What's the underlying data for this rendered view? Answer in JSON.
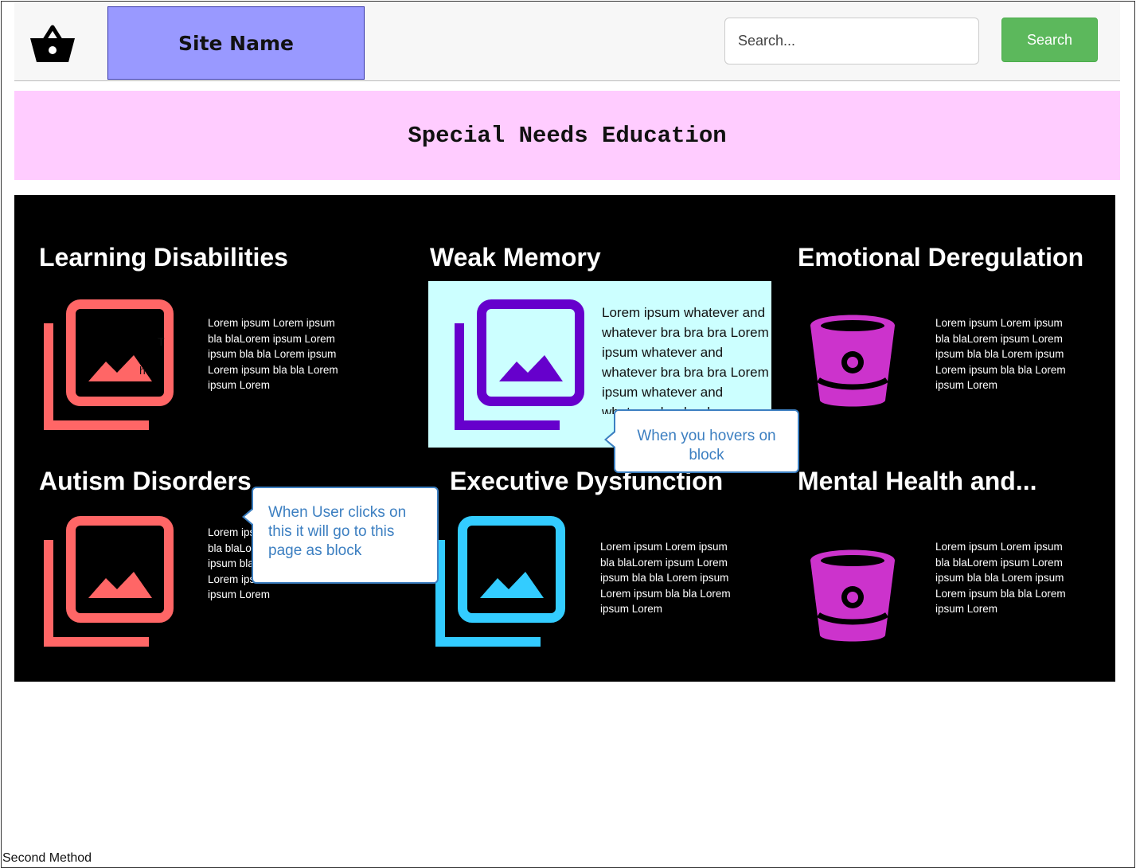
{
  "header": {
    "site_name": "Site Name",
    "search_placeholder": "Search...",
    "search_button": "Search"
  },
  "banner": {
    "title": "Special Needs Education"
  },
  "cards": [
    {
      "title": "Learning Disabilities",
      "icon": "image-gallery-icon",
      "color": "#ff6666",
      "text": "Lorem ipsum Lorem ipsum bla blaLorem ipsum Lorem ipsum bla bla Lorem ipsum Lorem ipsum bla bla Lorem ipsum Lorem"
    },
    {
      "title": "Weak Memory",
      "icon": "image-gallery-icon",
      "color": "#6600cc",
      "text": "Lorem ipsum whatever and whatever bra bra bra Lorem ipsum whatever and whatever bra bra bra Lorem ipsum whatever and whatever bra bra bra"
    },
    {
      "title": "Emotional Deregulation",
      "icon": "bitbucket-icon",
      "color": "#cc33cc",
      "text": "Lorem ipsum Lorem ipsum bla blaLorem ipsum Lorem ipsum bla bla Lorem ipsum Lorem ipsum bla bla Lorem ipsum Lorem"
    },
    {
      "title": "Autism Disorders",
      "icon": "image-gallery-icon",
      "color": "#ff6666",
      "text": "Lorem ipsum Lorem ipsum bla blaLorem ipsum Lorem ipsum bla bla Lorem ipsum Lorem ipsum bla bla Lorem ipsum Lorem"
    },
    {
      "title": "Executive Dysfunction",
      "icon": "image-gallery-icon",
      "color": "#33ccff",
      "text": "Lorem ipsum Lorem ipsum bla blaLorem ipsum Lorem ipsum bla bla Lorem ipsum Lorem ipsum bla bla Lorem ipsum Lorem"
    },
    {
      "title": "Mental Health and...",
      "icon": "bitbucket-icon",
      "color": "#cc33cc",
      "text": "Lorem ipsum Lorem ipsum bla blaLorem ipsum Lorem ipsum bla bla Lorem ipsum Lorem ipsum bla bla Lorem ipsum Lorem"
    }
  ],
  "callouts": {
    "hover": "When you hovers on block",
    "click": "When User clicks on this it will go to this page as block"
  },
  "footer": {
    "label": "Second Method"
  },
  "colors": {
    "header_bg": "#f7f7f7",
    "site_name_bg": "#9999ff",
    "banner_bg": "#ffccff",
    "search_button": "#5cb85c",
    "hover_bg": "#ccffff",
    "callout": "#3c7fc1"
  }
}
